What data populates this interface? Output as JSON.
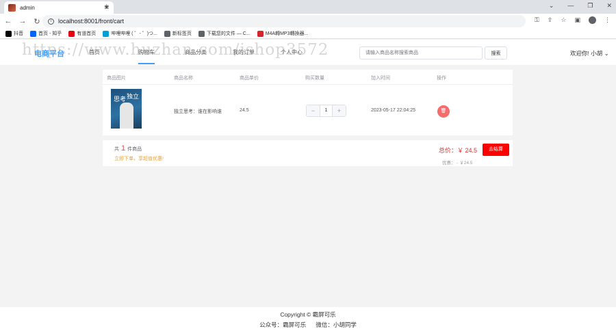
{
  "browser": {
    "tab_title": "admin",
    "url": "localhost:8001/front/cart",
    "bookmarks": [
      "抖音",
      "首页 - 知乎",
      "有道首页",
      "哔哩哔哩 ( ゜- ゜)つ...",
      "新标签页",
      "下载您的文件 — C...",
      "M4A轉MP3轉換器..."
    ],
    "bookmark_colors": [
      "#000000",
      "#0066ff",
      "#e60012",
      "#00a1d6",
      "#5f6368",
      "#5f6368",
      "#d8242b"
    ]
  },
  "header": {
    "logo": "电商平台",
    "nav": [
      "首页",
      "购物车",
      "商品分类",
      "我的订单",
      "个人中心"
    ],
    "search_placeholder": "请输入商品名称搜索商品",
    "search_button": "搜索",
    "greeting": "欢迎你! 小胡"
  },
  "watermark": "https://www.huzhan.com/ishop3572",
  "cart": {
    "columns": [
      "商品图片",
      "商品名称",
      "商品单价",
      "购买数量",
      "加入时间",
      "操作"
    ],
    "rows": [
      {
        "name": "独立思考：谁在影响谁",
        "price": "24.5",
        "quantity": "1",
        "added_time": "2023-05-17 22:04:25",
        "delete_icon": "trash-icon"
      }
    ]
  },
  "summary": {
    "count_prefix": "共",
    "count": "1",
    "count_suffix": "件商品",
    "promo": "立即下单，享超值优惠!",
    "total": "总价：￥ 24.5",
    "checkout": "去结算",
    "discount": "优惠： - ￥24.5"
  },
  "footer": {
    "copyright": "Copyright © 霸屏可乐",
    "contact": "公众号：霸屏可乐      微信：小胡同学"
  },
  "colors": {
    "accent": "#409eff",
    "danger": "#f56c6c",
    "checkout": "#ff0000",
    "price": "#e52b2b"
  }
}
